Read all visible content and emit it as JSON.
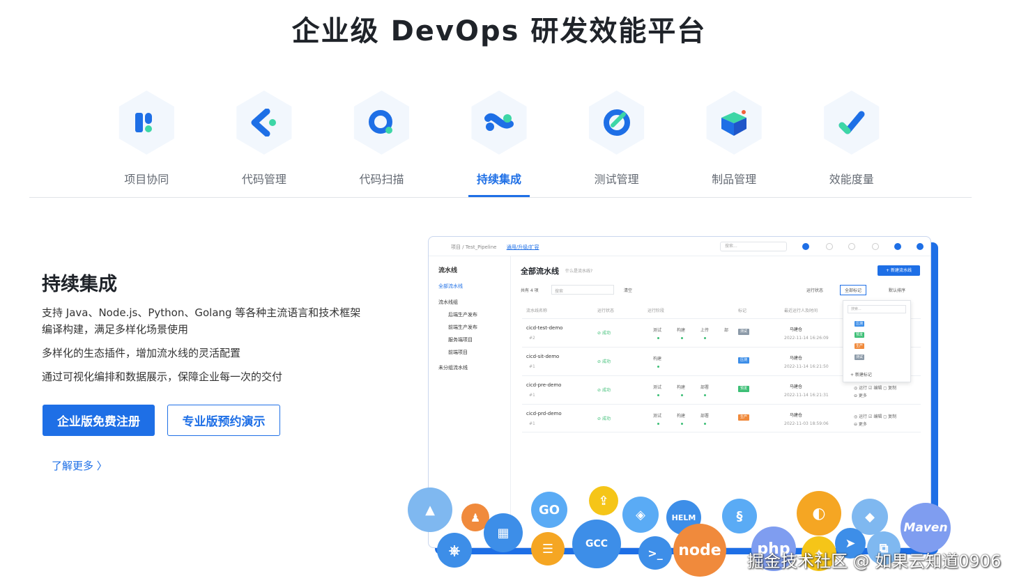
{
  "page": {
    "title": "企业级 DevOps 研发效能平台"
  },
  "tabs": [
    {
      "label": "项目协同",
      "icon": "project-collab-icon"
    },
    {
      "label": "代码管理",
      "icon": "code-management-icon"
    },
    {
      "label": "代码扫描",
      "icon": "code-scan-icon"
    },
    {
      "label": "持续集成",
      "icon": "continuous-integration-icon",
      "active": true
    },
    {
      "label": "测试管理",
      "icon": "test-management-icon"
    },
    {
      "label": "制品管理",
      "icon": "artifact-management-icon"
    },
    {
      "label": "效能度量",
      "icon": "efficiency-metrics-icon"
    }
  ],
  "feature": {
    "title": "持续集成",
    "desc1": "支持 Java、Node.js、Python、Golang 等各种主流语言和技术框架编译构建，满足多样化场景使用",
    "desc2": "多样化的生态插件，增加流水线的灵活配置",
    "desc3": "通过可视化编排和数据展示，保障企业每一次的交付",
    "primary_button": "企业版免费注册",
    "secondary_button": "专业版预约演示",
    "learn_more": "了解更多 〉"
  },
  "screenshot": {
    "breadcrumb": "项目 / Test_Pipeline",
    "breadcrumb_link": "通用/升级/扩容",
    "search_placeholder": "搜索...",
    "sidebar": {
      "pipeline": "流水线",
      "all_pipelines": "全部流水线",
      "pipeline_group": "流水线组",
      "group_items": [
        "后端生产发布",
        "前端生产发布",
        "服务端项目",
        "前端项目"
      ],
      "ungrouped": "未分组流水线"
    },
    "heading": "全部流水线",
    "hint": "什么是流水线?",
    "new_button": "+ 新建流水线",
    "total": "共有 4 项",
    "search": "搜索",
    "clear": "清空",
    "filter_status": "运行状态",
    "filter_tag": "全部标记",
    "filter_sort": "默认排序",
    "columns": [
      "流水线名称",
      "运行状态",
      "运行阶段",
      "标记",
      "最近运行人及时间"
    ],
    "rows": [
      {
        "name": "cicd-test-demo",
        "num": "#2",
        "status": "成功",
        "stages": [
          "测试",
          "构建",
          "上传",
          "部"
        ],
        "tag": "测试",
        "tag_color": "#8c9aa8",
        "user": "马建仓",
        "time": "2022-11-14 16:26:09",
        "ops": ""
      },
      {
        "name": "cicd-sit-demo",
        "num": "#1",
        "status": "成功",
        "stages": [
          "构建"
        ],
        "tag": "压测",
        "tag_color": "#3d8ee8",
        "user": "马建仓",
        "time": "2022-11-14 16:21:50",
        "ops": ""
      },
      {
        "name": "cicd-pre-demo",
        "num": "#1",
        "status": "成功",
        "stages": [
          "测试",
          "构建",
          "部署"
        ],
        "tag": "预发",
        "tag_color": "#3dbf76",
        "user": "马建仓",
        "time": "2022-11-14 16:21:31",
        "ops": "◎ 运行  ☑ 编辑  ◻ 复制"
      },
      {
        "name": "cicd-prd-demo",
        "num": "#1",
        "status": "成功",
        "stages": [
          "测试",
          "构建",
          "部署"
        ],
        "tag": "生产",
        "tag_color": "#f08a3c",
        "user": "马建仓",
        "time": "2022-11-03 18:59:06",
        "ops": "◎ 运行  ☑ 编辑  ◻ 复制"
      }
    ],
    "ops_more": "⊖ 更多",
    "dropdown": {
      "placeholder": "搜索...",
      "options": [
        {
          "label": "压测",
          "color": "#3d8ee8"
        },
        {
          "label": "预发",
          "color": "#3dbf76"
        },
        {
          "label": "生产",
          "color": "#f08a3c"
        },
        {
          "label": "测试",
          "color": "#8c9aa8"
        }
      ],
      "add": "+  新建标记"
    }
  },
  "bubbles": {
    "go": "GO",
    "helm": "HELM",
    "node": "node",
    "php": "php",
    "maven": "Maven",
    "gcc": "GCC"
  },
  "watermark": "掘金技术社区 @ 如果云知道0906",
  "colors": {
    "accent": "#1e6fe6",
    "success": "#3dbf76",
    "icon_teal": "#3dd6a6"
  }
}
